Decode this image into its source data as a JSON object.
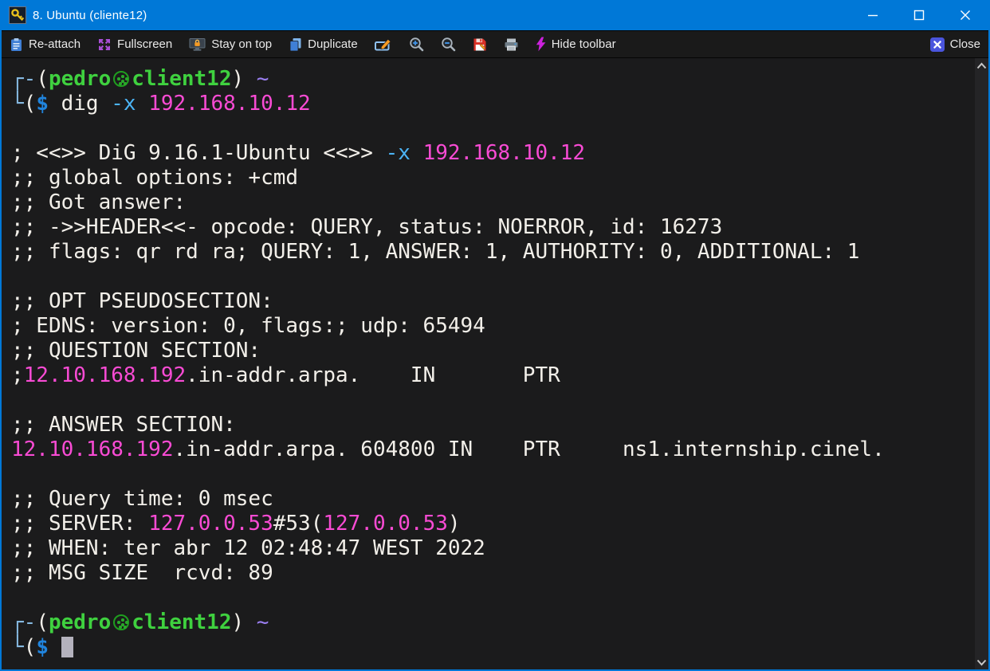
{
  "window": {
    "title": "8. Ubuntu (cliente12)",
    "app_icon": "key-icon",
    "controls": {
      "minimize": "minimize-icon",
      "maximize": "maximize-icon",
      "close": "close-icon"
    }
  },
  "colors": {
    "accent_titlebar": "#0078d7",
    "toolbar_bg": "#1a1a1a",
    "terminal_bg": "#1b1b1c",
    "terminal_white": "#f2efe9",
    "terminal_pink": "#f94bd4",
    "terminal_cyan": "#4cb4f5",
    "terminal_green": "#3fd13f",
    "prompt_bracket_blue": "#85b8e0",
    "dollar_blue": "#2084dd",
    "tilde_violet": "#9b7ff2",
    "fullscreen_icon_purple": "#a94fd6",
    "lightning_icon_magenta": "#cc22dd",
    "close_icon_indigo": "#4a55dd"
  },
  "toolbar": {
    "reattach": "Re-attach",
    "fullscreen": "Fullscreen",
    "stay_on_top": "Stay on top",
    "duplicate": "Duplicate",
    "hide_toolbar": "Hide toolbar",
    "close": "Close",
    "icon_only_buttons": [
      "edit-icon",
      "zoom-in-icon",
      "zoom-out-icon",
      "save-icon",
      "print-icon"
    ]
  },
  "scrollbar": {
    "up": "chevron-up-icon",
    "down": "chevron-down-icon"
  },
  "terminal": {
    "lines": [
      [
        {
          "t": "┌-",
          "c": "k"
        },
        {
          "t": "(",
          "c": "w"
        },
        {
          "t": "pedro",
          "c": "g"
        },
        {
          "icon": "kali-user-icon",
          "t": "㉿"
        },
        {
          "t": "client12",
          "c": "g"
        },
        {
          "t": ") ",
          "c": "w"
        },
        {
          "t": "~",
          "c": "v"
        }
      ],
      [
        {
          "t": "└",
          "c": "k"
        },
        {
          "t": "(",
          "c": "w"
        },
        {
          "t": "$",
          "c": "d"
        },
        {
          "t": " dig ",
          "c": "w"
        },
        {
          "t": "-x",
          "c": "c"
        },
        {
          "t": " ",
          "c": "w"
        },
        {
          "t": "192.168.10.12",
          "c": "p"
        }
      ],
      [],
      [
        {
          "t": "; <<>> DiG 9.16.1-Ubuntu <<>> ",
          "c": "w"
        },
        {
          "t": "-x",
          "c": "c"
        },
        {
          "t": " ",
          "c": "w"
        },
        {
          "t": "192.168.10.12",
          "c": "p"
        }
      ],
      [
        {
          "t": ";; global options: +cmd",
          "c": "w"
        }
      ],
      [
        {
          "t": ";; Got answer:",
          "c": "w"
        }
      ],
      [
        {
          "t": ";; ->>HEADER<<- opcode: QUERY, status: NOERROR, id: 16273",
          "c": "w"
        }
      ],
      [
        {
          "t": ";; flags: qr rd ra; QUERY: 1, ANSWER: 1, AUTHORITY: 0, ADDITIONAL: 1",
          "c": "w"
        }
      ],
      [],
      [
        {
          "t": ";; OPT PSEUDOSECTION:",
          "c": "w"
        }
      ],
      [
        {
          "t": "; EDNS: version: 0, flags:; udp: 65494",
          "c": "w"
        }
      ],
      [
        {
          "t": ";; QUESTION SECTION:",
          "c": "w"
        }
      ],
      [
        {
          "t": ";",
          "c": "w"
        },
        {
          "t": "12.10.168.192",
          "c": "p"
        },
        {
          "t": ".in-addr.arpa.    IN       PTR",
          "c": "w"
        }
      ],
      [],
      [
        {
          "t": ";; ANSWER SECTION:",
          "c": "w"
        }
      ],
      [
        {
          "t": "12.10.168.192",
          "c": "p"
        },
        {
          "t": ".in-addr.arpa. 604800 IN    PTR     ns1.internship.cinel.",
          "c": "w"
        }
      ],
      [],
      [
        {
          "t": ";; Query time: 0 msec",
          "c": "w"
        }
      ],
      [
        {
          "t": ";; SERVER: ",
          "c": "w"
        },
        {
          "t": "127.0.0.53",
          "c": "p"
        },
        {
          "t": "#53(",
          "c": "w"
        },
        {
          "t": "127.0.0.53",
          "c": "p"
        },
        {
          "t": ")",
          "c": "w"
        }
      ],
      [
        {
          "t": ";; WHEN: ter abr 12 02:48:47 WEST 2022",
          "c": "w"
        }
      ],
      [
        {
          "t": ";; MSG SIZE  rcvd: 89",
          "c": "w"
        }
      ],
      [],
      [
        {
          "t": "┌-",
          "c": "k"
        },
        {
          "t": "(",
          "c": "w"
        },
        {
          "t": "pedro",
          "c": "g"
        },
        {
          "icon": "kali-user-icon",
          "t": "㉿"
        },
        {
          "t": "client12",
          "c": "g"
        },
        {
          "t": ") ",
          "c": "w"
        },
        {
          "t": "~",
          "c": "v"
        }
      ],
      [
        {
          "t": "└",
          "c": "k"
        },
        {
          "t": "(",
          "c": "w"
        },
        {
          "t": "$",
          "c": "d"
        },
        {
          "t": " ",
          "c": "w"
        },
        {
          "cursor": true
        }
      ]
    ]
  }
}
